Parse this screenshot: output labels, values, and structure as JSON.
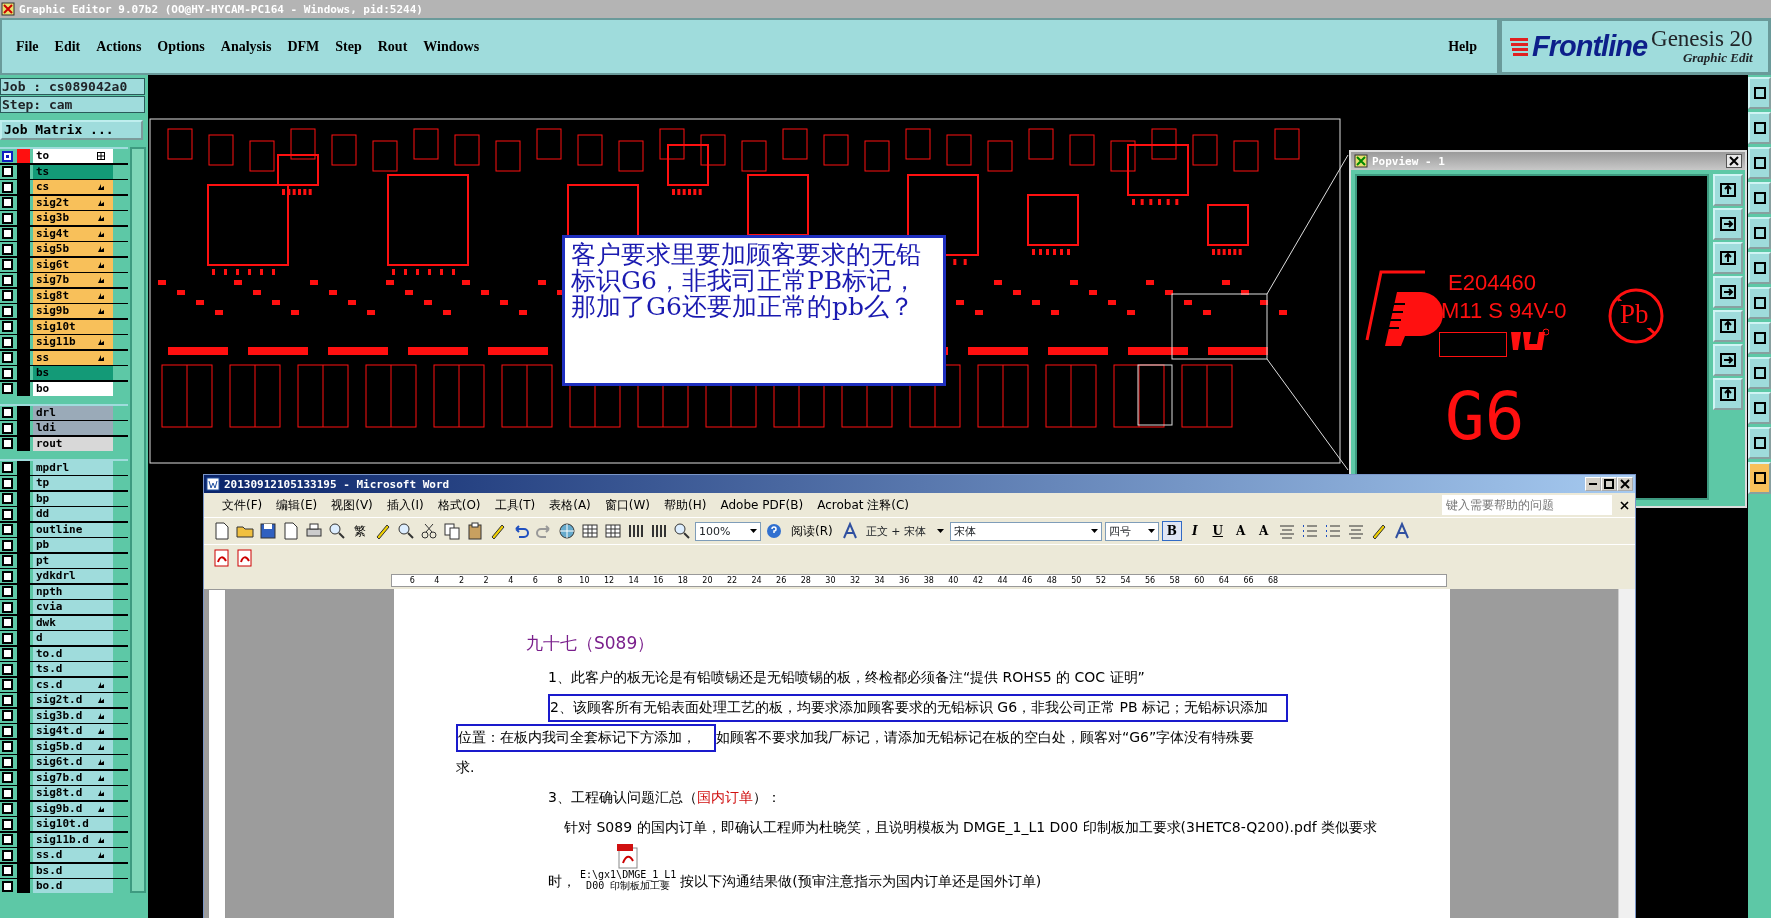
{
  "window": {
    "title": "Graphic Editor 9.07b2 (OO@HY-HYCAM-PC164 - Windows, pid:5244)"
  },
  "menu_bar": {
    "items": [
      "File",
      "Edit",
      "Actions",
      "Options",
      "Analysis",
      "DFM",
      "Step",
      "Rout",
      "Windows"
    ],
    "help": "Help"
  },
  "logo": {
    "brand": "Frontline",
    "product": "Genesis 20",
    "subtitle": "Graphic Edit"
  },
  "job_panel": {
    "job": "Job : cs089042a0",
    "step": "Step: cam",
    "matrix_button": "Job Matrix ..."
  },
  "layer_groups": [
    [
      {
        "name": "to",
        "color": "#ffffff",
        "affected": true,
        "displayed": true,
        "grid": true,
        "pointer": false
      },
      {
        "name": "ts",
        "color": "#139a77",
        "affected": false,
        "displayed": false,
        "grid": false,
        "pointer": false
      },
      {
        "name": "cs",
        "color": "#f8c05a",
        "affected": false,
        "displayed": false,
        "grid": false,
        "pointer": true
      },
      {
        "name": "sig2t",
        "color": "#f8c05a",
        "affected": false,
        "displayed": false,
        "grid": false,
        "pointer": true
      },
      {
        "name": "sig3b",
        "color": "#f8c05a",
        "affected": false,
        "displayed": false,
        "grid": false,
        "pointer": true
      },
      {
        "name": "sig4t",
        "color": "#f8c05a",
        "affected": false,
        "displayed": false,
        "grid": false,
        "pointer": true
      },
      {
        "name": "sig5b",
        "color": "#f8c05a",
        "affected": false,
        "displayed": false,
        "grid": false,
        "pointer": true
      },
      {
        "name": "sig6t",
        "color": "#f8c05a",
        "affected": false,
        "displayed": false,
        "grid": false,
        "pointer": true
      },
      {
        "name": "sig7b",
        "color": "#f8c05a",
        "affected": false,
        "displayed": false,
        "grid": false,
        "pointer": true
      },
      {
        "name": "sig8t",
        "color": "#f8c05a",
        "affected": false,
        "displayed": false,
        "grid": false,
        "pointer": true
      },
      {
        "name": "sig9b",
        "color": "#f8c05a",
        "affected": false,
        "displayed": false,
        "grid": false,
        "pointer": true
      },
      {
        "name": "sig10t",
        "color": "#f8c05a",
        "affected": false,
        "displayed": false,
        "grid": false,
        "pointer": false
      },
      {
        "name": "sig11b",
        "color": "#f8c05a",
        "affected": false,
        "displayed": false,
        "grid": false,
        "pointer": true
      },
      {
        "name": "ss",
        "color": "#f8c05a",
        "affected": false,
        "displayed": false,
        "grid": false,
        "pointer": true
      },
      {
        "name": "bs",
        "color": "#139a77",
        "affected": false,
        "displayed": false,
        "grid": false,
        "pointer": false
      },
      {
        "name": "bo",
        "color": "#ffffff",
        "affected": false,
        "displayed": false,
        "grid": false,
        "pointer": false
      }
    ],
    [
      {
        "name": "drl",
        "color": "#9aaab8",
        "affected": false,
        "displayed": false,
        "grid": false,
        "pointer": false
      },
      {
        "name": "ldi",
        "color": "#9aaab8",
        "affected": false,
        "displayed": false,
        "grid": false,
        "pointer": false
      },
      {
        "name": "rout",
        "color": "#d8d8d8",
        "affected": false,
        "displayed": false,
        "grid": false,
        "pointer": false
      }
    ],
    [
      {
        "name": "mpdrl",
        "color": "#9fdcdc",
        "affected": false,
        "displayed": false,
        "grid": false,
        "pointer": false
      },
      {
        "name": "tp",
        "color": "#9fdcdc",
        "affected": false,
        "displayed": false,
        "grid": false,
        "pointer": false
      },
      {
        "name": "bp",
        "color": "#9fdcdc",
        "affected": false,
        "displayed": false,
        "grid": false,
        "pointer": false
      },
      {
        "name": "dd",
        "color": "#9fdcdc",
        "affected": false,
        "displayed": false,
        "grid": false,
        "pointer": false
      },
      {
        "name": "outline",
        "color": "#9fdcdc",
        "affected": false,
        "displayed": false,
        "grid": false,
        "pointer": false
      },
      {
        "name": "pb",
        "color": "#9fdcdc",
        "affected": false,
        "displayed": false,
        "grid": false,
        "pointer": false
      },
      {
        "name": "pt",
        "color": "#9fdcdc",
        "affected": false,
        "displayed": false,
        "grid": false,
        "pointer": false
      },
      {
        "name": "ydkdrl",
        "color": "#9fdcdc",
        "affected": false,
        "displayed": false,
        "grid": false,
        "pointer": false
      },
      {
        "name": "npth",
        "color": "#9fdcdc",
        "affected": false,
        "displayed": false,
        "grid": false,
        "pointer": false
      },
      {
        "name": "cvia",
        "color": "#9fdcdc",
        "affected": false,
        "displayed": false,
        "grid": false,
        "pointer": false
      },
      {
        "name": "dwk",
        "color": "#9fdcdc",
        "affected": false,
        "displayed": false,
        "grid": false,
        "pointer": false
      },
      {
        "name": "d",
        "color": "#9fdcdc",
        "affected": false,
        "displayed": false,
        "grid": false,
        "pointer": false
      },
      {
        "name": "to.d",
        "color": "#9fdcdc",
        "affected": false,
        "displayed": false,
        "grid": false,
        "pointer": false
      },
      {
        "name": "ts.d",
        "color": "#9fdcdc",
        "affected": false,
        "displayed": false,
        "grid": false,
        "pointer": false
      },
      {
        "name": "cs.d",
        "color": "#9fdcdc",
        "affected": false,
        "displayed": false,
        "grid": false,
        "pointer": true
      },
      {
        "name": "sig2t.d",
        "color": "#9fdcdc",
        "affected": false,
        "displayed": false,
        "grid": false,
        "pointer": true
      },
      {
        "name": "sig3b.d",
        "color": "#9fdcdc",
        "affected": false,
        "displayed": false,
        "grid": false,
        "pointer": true
      },
      {
        "name": "sig4t.d",
        "color": "#9fdcdc",
        "affected": false,
        "displayed": false,
        "grid": false,
        "pointer": true
      },
      {
        "name": "sig5b.d",
        "color": "#9fdcdc",
        "affected": false,
        "displayed": false,
        "grid": false,
        "pointer": true
      },
      {
        "name": "sig6t.d",
        "color": "#9fdcdc",
        "affected": false,
        "displayed": false,
        "grid": false,
        "pointer": true
      },
      {
        "name": "sig7b.d",
        "color": "#9fdcdc",
        "affected": false,
        "displayed": false,
        "grid": false,
        "pointer": true
      },
      {
        "name": "sig8t.d",
        "color": "#9fdcdc",
        "affected": false,
        "displayed": false,
        "grid": false,
        "pointer": true
      },
      {
        "name": "sig9b.d",
        "color": "#9fdcdc",
        "affected": false,
        "displayed": false,
        "grid": false,
        "pointer": true
      },
      {
        "name": "sig10t.d",
        "color": "#9fdcdc",
        "affected": false,
        "displayed": false,
        "grid": false,
        "pointer": false
      },
      {
        "name": "sig11b.d",
        "color": "#9fdcdc",
        "affected": false,
        "displayed": false,
        "grid": false,
        "pointer": true
      },
      {
        "name": "ss.d",
        "color": "#9fdcdc",
        "affected": false,
        "displayed": false,
        "grid": false,
        "pointer": true
      },
      {
        "name": "bs.d",
        "color": "#9fdcdc",
        "affected": false,
        "displayed": false,
        "grid": false,
        "pointer": false
      },
      {
        "name": "bo.d",
        "color": "#9fdcdc",
        "affected": false,
        "displayed": false,
        "grid": false,
        "pointer": false
      }
    ]
  ],
  "annotation": {
    "text": "客户要求里要加顾客要求的无铅标识G6，非我司正常PB标记，那加了G6还要加正常的pb么？"
  },
  "popview": {
    "title": "Popview - 1",
    "ul_number": "E204460",
    "rating": "M11 S 94V-0",
    "lead_free_mark": "Pb",
    "marking": "G6"
  },
  "word": {
    "title": "20130912105133195 - Microsoft Word",
    "menus": [
      "文件(F)",
      "编辑(E)",
      "视图(V)",
      "插入(I)",
      "格式(O)",
      "工具(T)",
      "表格(A)",
      "窗口(W)",
      "帮助(H)",
      "Adobe PDF(B)",
      "Acrobat 注释(C)"
    ],
    "help_box": {
      "placeholder": "键入需要帮助的问题"
    },
    "toolbar": {
      "traditional_chinese": "繁",
      "zoom": "100%",
      "read_button": "阅读(R)",
      "style": "正文 + 宋体",
      "font": "宋体",
      "size": "四号",
      "format_buttons": [
        {
          "label": "B",
          "selected": true
        },
        {
          "label": "I",
          "selected": false
        },
        {
          "label": "U",
          "selected": false
        },
        {
          "label": "A",
          "selected": false
        },
        {
          "label": "A",
          "selected": false
        }
      ]
    },
    "ruler": [
      "6",
      "4",
      "2",
      "2",
      "4",
      "6",
      "8",
      "10",
      "12",
      "14",
      "16",
      "18",
      "20",
      "22",
      "24",
      "26",
      "28",
      "30",
      "32",
      "34",
      "36",
      "38",
      "40",
      "42",
      "44",
      "46",
      "48",
      "50",
      "52",
      "54",
      "56",
      "58",
      "60",
      "64",
      "66",
      "68"
    ],
    "lines": [
      {
        "kind": "heading",
        "segments": [
          {
            "text": "九十七（S089）",
            "boxed": false,
            "colored": false
          }
        ]
      },
      {
        "kind": "item",
        "segments": [
          {
            "text": "1、此客户的板无论是有铅喷锡还是无铅喷锡的板，终检都必须备注“提供 ROHS5 的 COC 证明”",
            "boxed": false,
            "colored": false
          }
        ]
      },
      {
        "kind": "item",
        "segments": [
          {
            "text": "2、该顾客所有无铅表面处理工艺的板，均要求添加顾客要求的无铅标识 G6，非我公司正常 PB 标记；无铅标识添加",
            "boxed": true,
            "colored": false
          }
        ]
      },
      {
        "kind": "continuation",
        "segments": [
          {
            "text": "位置：在板内我司全套标记下方添加，",
            "boxed": true,
            "colored": false
          },
          {
            "text": "如顾客不要求加我厂标记，请添加无铅标记在板的空白处，顾客对“G6”字体没有特殊要",
            "boxed": false,
            "colored": false
          }
        ]
      },
      {
        "kind": "continuation",
        "segments": [
          {
            "text": "求.",
            "boxed": false,
            "colored": false
          }
        ]
      },
      {
        "kind": "item",
        "segments": [
          {
            "text": "3、工程确认问题汇总（",
            "boxed": false,
            "colored": false
          },
          {
            "text": "国内订单",
            "boxed": false,
            "colored": true
          },
          {
            "text": "）：",
            "boxed": false,
            "colored": false
          }
        ]
      },
      {
        "kind": "body",
        "segments": [
          {
            "text": "针对 S089 的国内订单，即确认工程师为杜晓笑，且说明模板为 DMGE_1_L1  D00 印制板加工要求(3HETC8-Q200).pdf 类似要求",
            "boxed": false,
            "colored": false
          }
        ]
      }
    ],
    "attachment": {
      "lead": "时，",
      "caption_lines": [
        "E:\\gx1\\DMGE_1_L1",
        "D00 印制板加工要"
      ],
      "follow": "按以下沟通结果做(预审注意指示为国内订单还是国外订单)"
    }
  }
}
